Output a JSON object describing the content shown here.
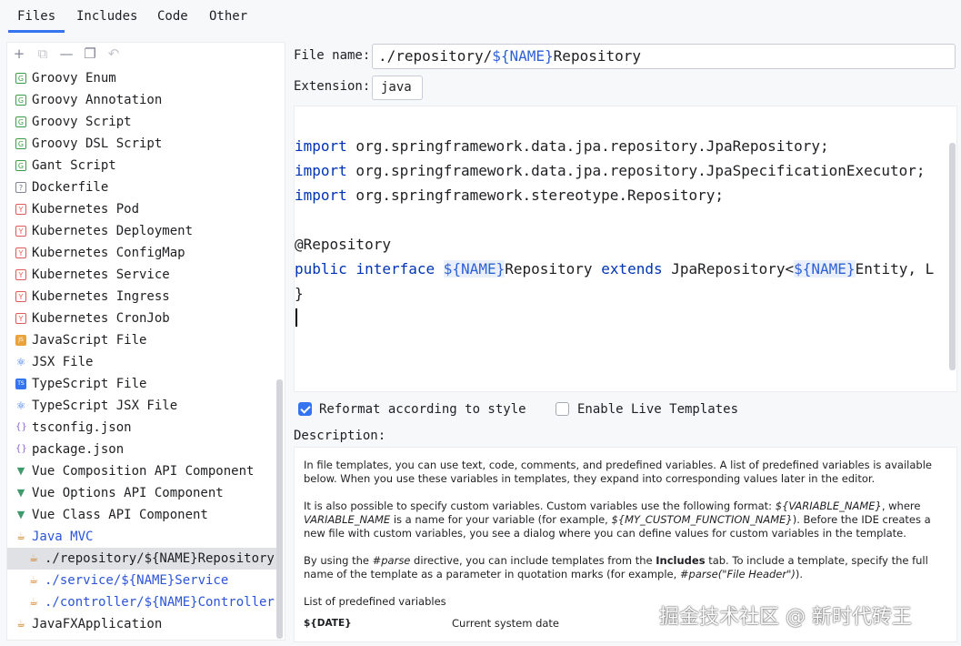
{
  "tabs": [
    "Files",
    "Includes",
    "Code",
    "Other"
  ],
  "toolbar": {
    "add": "+",
    "copy": "⧉",
    "remove": "—",
    "duplicate": "❐",
    "reset": "↶"
  },
  "templates": [
    {
      "label": "Groovy Enum",
      "icon": "groovy-icon",
      "icon_text": "G"
    },
    {
      "label": "Groovy Annotation",
      "icon": "groovy-icon",
      "icon_text": "G"
    },
    {
      "label": "Groovy Script",
      "icon": "groovy-icon",
      "icon_text": "G"
    },
    {
      "label": "Groovy DSL Script",
      "icon": "groovy-icon",
      "icon_text": "G"
    },
    {
      "label": "Gant Script",
      "icon": "groovy-icon",
      "icon_text": "G"
    },
    {
      "label": "Dockerfile",
      "icon": "unknown-file-icon",
      "icon_text": "?"
    },
    {
      "label": "Kubernetes Pod",
      "icon": "yaml-icon",
      "icon_text": "Y"
    },
    {
      "label": "Kubernetes Deployment",
      "icon": "yaml-icon",
      "icon_text": "Y"
    },
    {
      "label": "Kubernetes ConfigMap",
      "icon": "yaml-icon",
      "icon_text": "Y"
    },
    {
      "label": "Kubernetes Service",
      "icon": "yaml-icon",
      "icon_text": "Y"
    },
    {
      "label": "Kubernetes Ingress",
      "icon": "yaml-icon",
      "icon_text": "Y"
    },
    {
      "label": "Kubernetes CronJob",
      "icon": "yaml-icon",
      "icon_text": "Y"
    },
    {
      "label": "JavaScript File",
      "icon": "javascript-icon",
      "icon_text": "JS"
    },
    {
      "label": "JSX File",
      "icon": "react-icon",
      "icon_text": "⚛"
    },
    {
      "label": "TypeScript File",
      "icon": "typescript-icon",
      "icon_text": "TS"
    },
    {
      "label": "TypeScript JSX File",
      "icon": "react-icon",
      "icon_text": "⚛"
    },
    {
      "label": "tsconfig.json",
      "icon": "json-icon",
      "icon_text": "{}"
    },
    {
      "label": "package.json",
      "icon": "json-icon",
      "icon_text": "{}"
    },
    {
      "label": "Vue Composition API Component",
      "icon": "vue-icon",
      "icon_text": "▼"
    },
    {
      "label": "Vue Options API Component",
      "icon": "vue-icon",
      "icon_text": "▼"
    },
    {
      "label": "Vue Class API Component",
      "icon": "vue-icon",
      "icon_text": "▼"
    },
    {
      "label": "Java MVC",
      "icon": "java-group-icon",
      "icon_text": "☕",
      "style": "blue"
    },
    {
      "label": "./repository/${NAME}Repository",
      "icon": "java-file-icon",
      "icon_text": "☕",
      "indent": true,
      "selected": true
    },
    {
      "label": "./service/${NAME}Service",
      "icon": "java-file-icon",
      "icon_text": "☕",
      "indent": true,
      "style": "blue"
    },
    {
      "label": "./controller/${NAME}Controller",
      "icon": "java-file-icon",
      "icon_text": "☕",
      "indent": true,
      "style": "blue"
    },
    {
      "label": "JavaFXApplication",
      "icon": "java-file-icon",
      "icon_text": "☕"
    }
  ],
  "form": {
    "file_name_label": "File name:",
    "file_name_prefix": "./repository/",
    "file_name_var": "${NAME}",
    "file_name_suffix": "Repository",
    "extension_label": "Extension:",
    "extension_value": "java"
  },
  "code": {
    "lines": [
      {
        "kw": "import",
        "rest": " org.springframework.data.jpa.repository.JpaRepository;"
      },
      {
        "kw": "import",
        "rest": " org.springframework.data.jpa.repository.JpaSpecificationExecutor;"
      },
      {
        "kw": "import",
        "rest": " org.springframework.stereotype.Repository;"
      }
    ],
    "annotation": "@Repository",
    "decl_kw1": "public",
    "decl_kw2": "interface",
    "decl_var1": "${NAME}",
    "decl_name": "Repository ",
    "decl_kw3": "extends",
    "decl_base": " JpaRepository<",
    "decl_var2": "${NAME}",
    "decl_tail": "Entity, L",
    "close": "}"
  },
  "options": {
    "reformat_label": "Reformat according to style",
    "reformat_checked": true,
    "live_templates_label": "Enable Live Templates",
    "live_templates_checked": false
  },
  "description": {
    "title": "Description:",
    "p1": "In file templates, you can use text, code, comments, and predefined variables. A list of predefined variables is available below. When you use these variables in templates, they expand into corresponding values later in the editor.",
    "p2a": "It is also possible to specify custom variables. Custom variables use the following format: ",
    "p2b": "${VARIABLE_NAME}",
    "p2c": ", where ",
    "p2d": "VARIABLE_NAME",
    "p2e": " is a name for your variable (for example, ",
    "p2f": "${MY_CUSTOM_FUNCTION_NAME}",
    "p2g": "). Before the IDE creates a new file with custom variables, you see a dialog where you can define values for custom variables in the template.",
    "p3a": "By using the ",
    "p3b": "#parse",
    "p3c": " directive, you can include templates from the ",
    "p3d": "Includes",
    "p3e": " tab. To include a template, specify the full name of the template as a parameter in quotation marks (for example, ",
    "p3f": "#parse",
    "p3g": "(\"File Header\")",
    "p3h": ").",
    "p4": "List of predefined variables",
    "var_name": "${DATE}",
    "var_desc": "Current system date"
  },
  "watermark": "掘金技术社区 @ 新时代砖王"
}
